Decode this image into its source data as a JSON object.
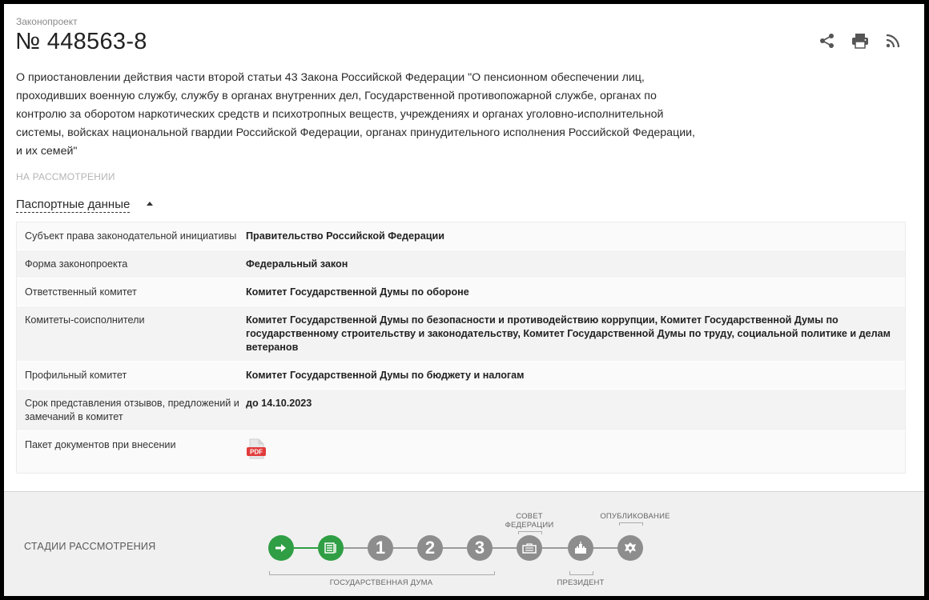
{
  "header": {
    "kicker": "Законопроект",
    "bill_number": "№ 448563-8",
    "description": "О приостановлении действия части второй статьи 43 Закона Российской Федерации \"О пенсионном обеспечении лиц, проходивших военную службу, службу в органах внутренних дел, Государственной противопожарной службе, органах по контролю за оборотом наркотических средств и психотропных веществ, учреждениях и органах уголовно-исполнительной системы, войсках национальной гвардии Российской Федерации, органах принудительного исполнения Российской Федерации, и их семей\"",
    "status": "НА РАССМОТРЕНИИ",
    "actions": [
      "share-icon",
      "print-icon",
      "rss-icon"
    ]
  },
  "passport": {
    "toggle_label": "Паспортные данные",
    "rows": [
      {
        "label": "Субъект права законодательной инициативы",
        "value": "Правительство Российской Федерации"
      },
      {
        "label": "Форма законопроекта",
        "value": "Федеральный закон"
      },
      {
        "label": "Ответственный комитет",
        "value": "Комитет Государственной Думы по обороне"
      },
      {
        "label": "Комитеты-соисполнители",
        "value": "Комитет Государственной Думы по безопасности и противодействию коррупции, Комитет Государственной Думы по государственному строительству и законодательству, Комитет Государственной Думы по труду, социальной политике и делам ветеранов"
      },
      {
        "label": "Профильный комитет",
        "value": "Комитет Государственной Думы по бюджету и налогам"
      },
      {
        "label": "Срок представления отзывов, предложений и замечаний в комитет",
        "value": "до 14.10.2023"
      },
      {
        "label": "Пакет документов при внесении",
        "value": "",
        "pdf_label": "PDF"
      }
    ]
  },
  "stages": {
    "title": "СТАДИИ РАССМОТРЕНИЯ",
    "steps": [
      {
        "label": "",
        "glyph": "arrow-right-icon",
        "status": "done"
      },
      {
        "label": "",
        "glyph": "document-list-icon",
        "status": "done"
      },
      {
        "label": "1",
        "glyph": "",
        "status": "pending"
      },
      {
        "label": "2",
        "glyph": "",
        "status": "pending"
      },
      {
        "label": "3",
        "glyph": "",
        "status": "pending"
      },
      {
        "label": "",
        "glyph": "federation-council-icon",
        "status": "pending"
      },
      {
        "label": "",
        "glyph": "president-icon",
        "status": "pending"
      },
      {
        "label": "",
        "glyph": "emblem-icon",
        "status": "pending"
      }
    ],
    "captions": {
      "duma": "ГОСУДАРСТВЕННАЯ ДУМА",
      "council_line1": "СОВЕТ",
      "council_line2": "ФЕДЕРАЦИИ",
      "president": "ПРЕЗИДЕНТ",
      "published": "ОПУБЛИКОВАНИЕ"
    },
    "colors": {
      "done": "#2f9e44",
      "pending": "#8d8d8d"
    }
  }
}
